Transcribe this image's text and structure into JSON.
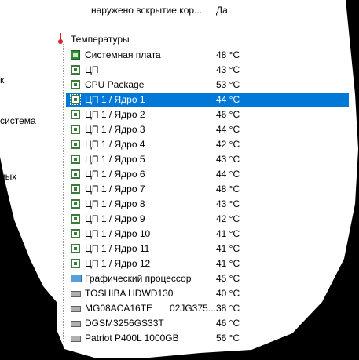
{
  "top_row": {
    "text": "наружено вскрытие кор...",
    "value": "Да"
  },
  "section": {
    "label": "Температуры"
  },
  "left_panel": [
    "к",
    "система",
    "ных"
  ],
  "sensors": [
    {
      "name": "Системная плата",
      "value": "48 °C",
      "icon": "motherboard-icon"
    },
    {
      "name": "ЦП",
      "value": "43 °C",
      "icon": "cpu-chip-icon"
    },
    {
      "name": "CPU Package",
      "value": "53 °C",
      "icon": "cpu-chip-icon"
    },
    {
      "name": "ЦП 1 / Ядро 1",
      "value": "44 °C",
      "icon": "cpu-chip-icon",
      "selected": true
    },
    {
      "name": "ЦП 1 / Ядро 2",
      "value": "46 °C",
      "icon": "cpu-chip-icon"
    },
    {
      "name": "ЦП 1 / Ядро 3",
      "value": "44 °C",
      "icon": "cpu-chip-icon"
    },
    {
      "name": "ЦП 1 / Ядро 4",
      "value": "42 °C",
      "icon": "cpu-chip-icon"
    },
    {
      "name": "ЦП 1 / Ядро 5",
      "value": "43 °C",
      "icon": "cpu-chip-icon"
    },
    {
      "name": "ЦП 1 / Ядро 6",
      "value": "44 °C",
      "icon": "cpu-chip-icon"
    },
    {
      "name": "ЦП 1 / Ядро 7",
      "value": "48 °C",
      "icon": "cpu-chip-icon"
    },
    {
      "name": "ЦП 1 / Ядро 8",
      "value": "43 °C",
      "icon": "cpu-chip-icon"
    },
    {
      "name": "ЦП 1 / Ядро 9",
      "value": "42 °C",
      "icon": "cpu-chip-icon"
    },
    {
      "name": "ЦП 1 / Ядро 10",
      "value": "41 °C",
      "icon": "cpu-chip-icon"
    },
    {
      "name": "ЦП 1 / Ядро 11",
      "value": "41 °C",
      "icon": "cpu-chip-icon"
    },
    {
      "name": "ЦП 1 / Ядро 12",
      "value": "41 °C",
      "icon": "cpu-chip-icon"
    },
    {
      "name": "Графический процессор",
      "value": "45 °C",
      "icon": "gpu-icon"
    },
    {
      "name": "TOSHIBA HDWD130",
      "value": "40 °C",
      "icon": "disk-icon"
    },
    {
      "name": "MG08ACA16TE",
      "extra": "02JG375...",
      "value": "38 °C",
      "icon": "disk-icon"
    },
    {
      "name": "DGSM3256GS33T",
      "value": "46 °C",
      "icon": "disk-icon"
    },
    {
      "name": "Patriot P400L 1000GB",
      "value": "56 °C",
      "icon": "disk-icon"
    }
  ],
  "colors": {
    "selection": "#0078d7",
    "chip": "#3c7a3c",
    "background": "#000000"
  }
}
